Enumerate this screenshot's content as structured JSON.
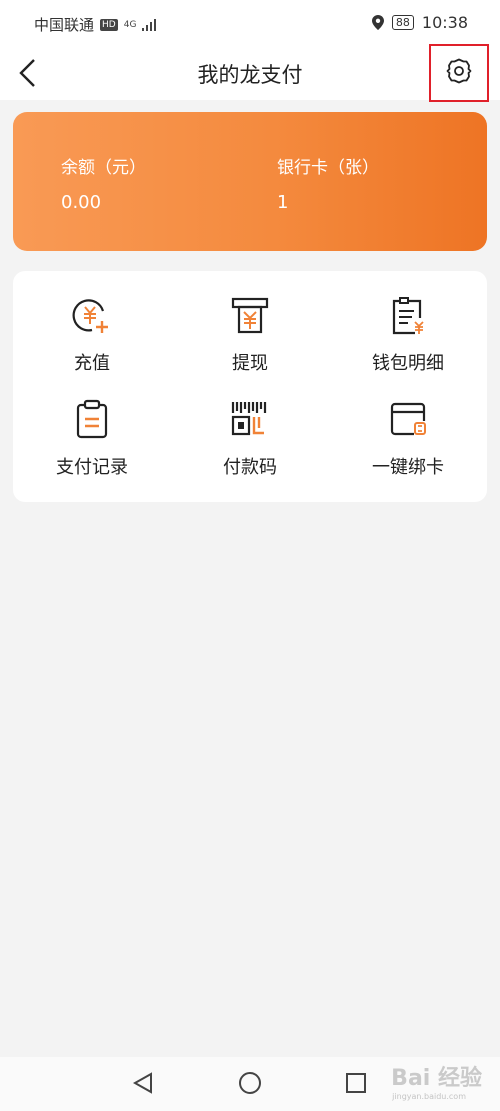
{
  "status_bar": {
    "carrier": "中国联通",
    "hd_badge": "HD",
    "network": "4G",
    "battery": "88",
    "time": "10:38"
  },
  "header": {
    "title": "我的龙支付"
  },
  "balance": {
    "label": "余额（元）",
    "value": "0.00"
  },
  "bank_cards": {
    "label": "银行卡（张）",
    "value": "1"
  },
  "menu": {
    "items": [
      {
        "label": "充值",
        "icon": "recharge-icon"
      },
      {
        "label": "提现",
        "icon": "withdraw-icon"
      },
      {
        "label": "钱包明细",
        "icon": "wallet-detail-icon"
      },
      {
        "label": "支付记录",
        "icon": "payment-record-icon"
      },
      {
        "label": "付款码",
        "icon": "payment-code-icon"
      },
      {
        "label": "一键绑卡",
        "icon": "bind-card-icon"
      }
    ]
  },
  "watermark": {
    "text": "Bai 经验",
    "sub": "jingyan.baidu.com"
  },
  "colors": {
    "accent": "#f08237",
    "highlight": "#e0202a"
  }
}
